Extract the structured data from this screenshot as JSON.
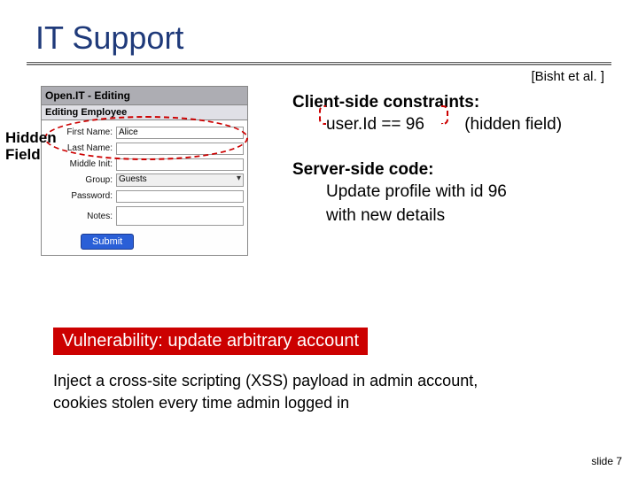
{
  "title": "IT Support",
  "citation": "[Bisht et al. ]",
  "form": {
    "header": "Open.IT - Editing",
    "subheader": "Editing Employee",
    "rows": {
      "firstname_label": "First Name:",
      "firstname_value": "Alice",
      "lastname_label": "Last Name:",
      "lastname_value": "",
      "middle_label": "Middle Init:",
      "middle_value": "",
      "group_label": "Group:",
      "group_value": "Guests",
      "password_label": "Password:",
      "password_value": "",
      "notes_label": "Notes:"
    },
    "submit": "Submit"
  },
  "hidden_field_label_line1": "Hidden",
  "hidden_field_label_line2": "Field",
  "client": {
    "heading": "Client-side constraints:",
    "expr": "user.Id == 96",
    "paren": "(hidden field)"
  },
  "server": {
    "heading": "Server-side code:",
    "line1": "Update profile with id 96",
    "line2": "with new details"
  },
  "vuln_box": "Vulnerability: update arbitrary account",
  "explain_line1": "Inject a cross-site scripting (XSS) payload in admin account,",
  "explain_line2": "cookies stolen every time admin logged in",
  "slide_number": "slide 7"
}
